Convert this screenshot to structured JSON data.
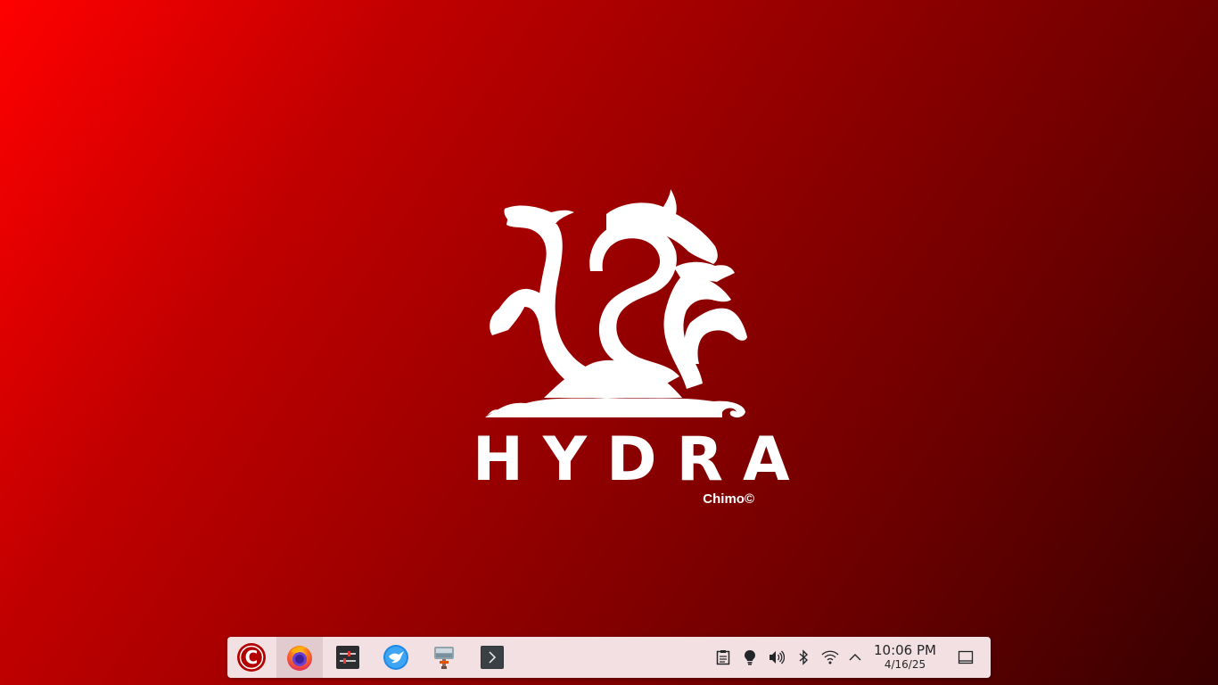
{
  "wallpaper": {
    "logo_title": "HYDRA",
    "logo_credit": "Chimo©",
    "colors": {
      "gradient_start": "#ff0000",
      "gradient_end": "#370000",
      "logo": "#ffffff"
    }
  },
  "taskbar": {
    "background": "#f2e0e2",
    "launchers": [
      {
        "name": "application-launcher",
        "icon": "hydra-c-logo-icon"
      },
      {
        "name": "firefox",
        "icon": "firefox-icon"
      },
      {
        "name": "system-settings",
        "icon": "settings-sliders-icon"
      },
      {
        "name": "discover",
        "icon": "blue-bird-icon"
      },
      {
        "name": "hammer-tool",
        "icon": "hammer-icon"
      },
      {
        "name": "terminal",
        "icon": "terminal-icon"
      }
    ],
    "tray": {
      "icons": [
        "clipboard-icon",
        "lightbulb-icon",
        "volume-icon",
        "bluetooth-icon",
        "wifi-icon",
        "chevron-up-icon"
      ]
    },
    "clock": {
      "time": "10:06 PM",
      "date": "4/16/25"
    },
    "show_desktop_icon": "show-desktop-icon"
  }
}
